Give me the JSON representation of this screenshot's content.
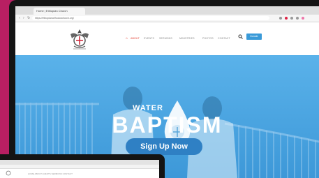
{
  "browser": {
    "tab_title": "Home | Ethiopian Church",
    "url": "https://ethiopianorthodoxchurch.org/"
  },
  "site": {
    "nav": {
      "items": [
        "About",
        "Events",
        "Sermons",
        "Ministries",
        "Photos",
        "Contact"
      ],
      "donate_label": "Donate"
    }
  },
  "hero": {
    "subtitle": "WATER",
    "title": "BAPTISM",
    "cta_label": "Sign Up Now"
  },
  "laptop": {
    "nav_items": "HOME  ABOUT  EVENTS  SERMONS  CONTACT"
  },
  "colors": {
    "background": "#b81f62",
    "hero_blue": "#4aa6e3",
    "button_blue": "#2f80c4",
    "accent_red": "#e23b2d"
  }
}
